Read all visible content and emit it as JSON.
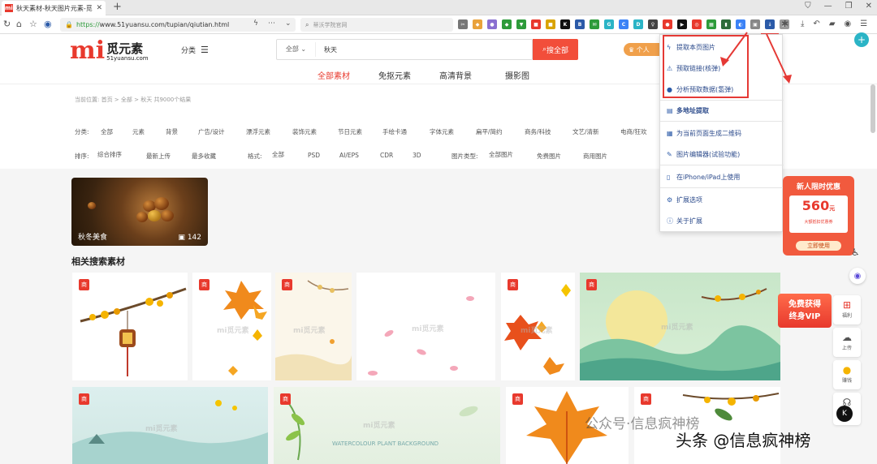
{
  "browser": {
    "tab_title": "秋天素材-秋天图片元素-觅元素",
    "tab_icon_text": "mi",
    "url_proto": "https://",
    "url_host": "www.51yuansu.com/tupian/qiutian.html",
    "search_placeholder": "蒂沃学院官网"
  },
  "site": {
    "logo_mark": "mi",
    "logo_cn": "觅元素",
    "logo_en": "51yuansu.com",
    "fenlei": "分类",
    "search_scope": "全部",
    "search_query": "秋天",
    "search_button": "搜全部",
    "personal": "个人"
  },
  "category_tabs": [
    "全部素材",
    "免抠元素",
    "高清背景",
    "摄影图"
  ],
  "breadcrumb": "当前位置: 首页 > 全部 > 秋天 共9000个结果",
  "filters": {
    "category_label": "分类:",
    "categories": [
      "全部",
      "元素",
      "背景",
      "广告/设计",
      "漂浮元素",
      "装饰元素",
      "节日元素",
      "手绘卡通",
      "字体元素",
      "扁平/简约",
      "商务/科技",
      "文艺/清新",
      "电商/狂欢"
    ],
    "sort_label": "排序:",
    "sorts": [
      "综合排序",
      "最新上传",
      "最多收藏"
    ],
    "format_label": "格式:",
    "formats": [
      "全部",
      "PSD",
      "AI/EPS",
      "CDR",
      "3D"
    ],
    "imgtype_label": "图片类型:",
    "imgtypes": [
      "全部图片",
      "免费图片",
      "商用图片"
    ]
  },
  "hero": {
    "label": "秋冬美食",
    "count": "142"
  },
  "related_title": "相关搜索素材",
  "badge": "商",
  "watermark": "mi觅元素",
  "card_text": "WATERCOLOUR PLANT BACKGROUND",
  "ext_menu": {
    "items": [
      "提取本页图片",
      "预取链接(核弹)",
      "分析预取数据(氢弹)",
      "多地址提取",
      "为当前页面生成二维码",
      "图片编辑器(试验功能)",
      "在iPhone/iPad上使用",
      "扩展选项",
      "关于扩展"
    ]
  },
  "promo": {
    "title": "新人限时优惠",
    "amount": "560",
    "unit": "元",
    "sub": "大额抵扣优惠券",
    "button": "立即使用"
  },
  "vip": {
    "line1": "免费获得",
    "line2": "终身VIP"
  },
  "sidebar": [
    "福利",
    "上传",
    "赚钱"
  ],
  "watermark_overlay": {
    "wechat": "公众号·信息疯神榜",
    "toutiao": "头条 @信息疯神榜"
  }
}
